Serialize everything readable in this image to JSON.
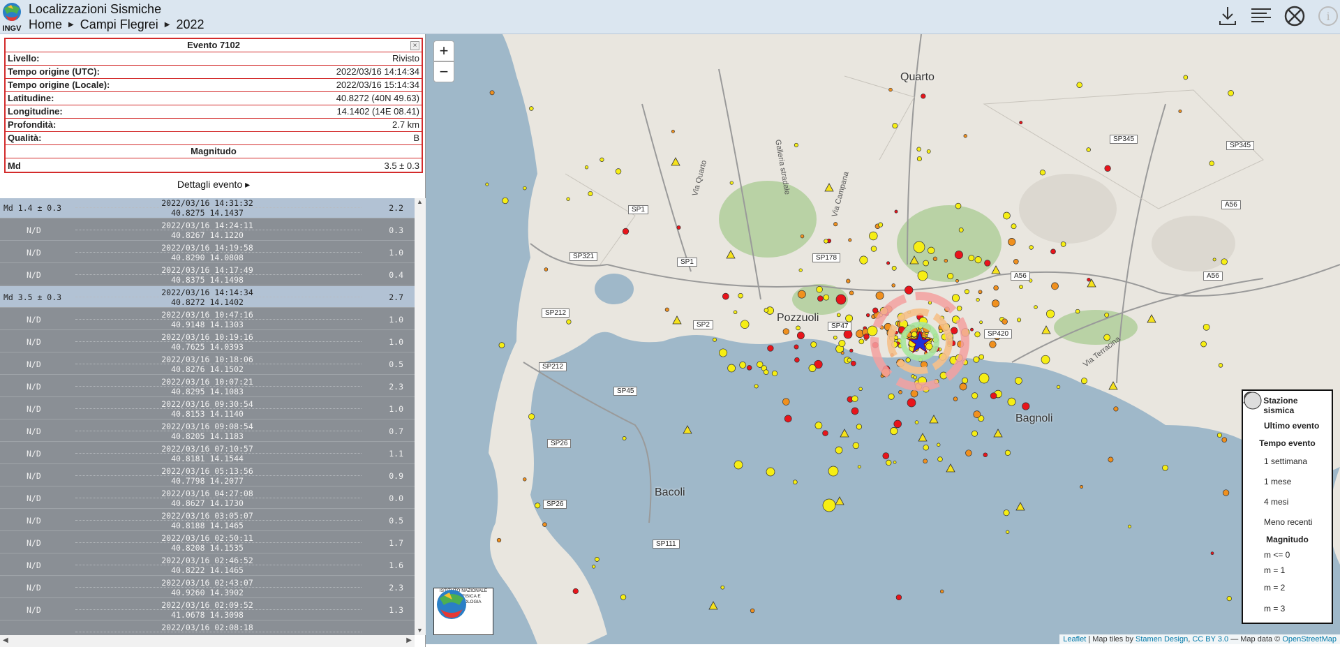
{
  "header": {
    "title": "Localizzazioni Sismiche",
    "logo_text": "INGV",
    "breadcrumb": [
      "Home",
      "Campi Flegrei",
      "2022"
    ]
  },
  "detail": {
    "title": "Evento 7102",
    "rows": [
      {
        "label": "Livello:",
        "value": "Rivisto"
      },
      {
        "label": "Tempo origine (UTC):",
        "value": "2022/03/16 14:14:34"
      },
      {
        "label": "Tempo origine (Locale):",
        "value": "2022/03/16 15:14:34"
      },
      {
        "label": "Latitudine:",
        "value": "40.8272 (40N 49.63)"
      },
      {
        "label": "Longitudine:",
        "value": "14.1402 (14E 08.41)"
      },
      {
        "label": "Profondità:",
        "value": "2.7 km"
      },
      {
        "label": "Qualità:",
        "value": "B"
      }
    ],
    "magnitude_header": "Magnitudo",
    "magnitude_label": "Md",
    "magnitude_value": "3.5 ± 0.3",
    "details_link": "Dettagli evento ▸"
  },
  "events": [
    {
      "mag": "Md 1.4 ± 0.3",
      "datetime": "2022/03/16 14:31:32",
      "coords": "40.8275 14.1437",
      "depth": "2.2",
      "hi": true
    },
    {
      "mag": "N/D",
      "datetime": "2022/03/16 14:24:11",
      "coords": "40.8267 14.1220",
      "depth": "0.3"
    },
    {
      "mag": "N/D",
      "datetime": "2022/03/16 14:19:58",
      "coords": "40.8290 14.0808",
      "depth": "1.0"
    },
    {
      "mag": "N/D",
      "datetime": "2022/03/16 14:17:49",
      "coords": "40.8375 14.1498",
      "depth": "0.4"
    },
    {
      "mag": "Md 3.5 ± 0.3",
      "datetime": "2022/03/16 14:14:34",
      "coords": "40.8272 14.1402",
      "depth": "2.7",
      "hi": true
    },
    {
      "mag": "N/D",
      "datetime": "2022/03/16 10:47:16",
      "coords": "40.9148 14.1303",
      "depth": "1.0"
    },
    {
      "mag": "N/D",
      "datetime": "2022/03/16 10:19:16",
      "coords": "40.7625 14.0393",
      "depth": "1.0"
    },
    {
      "mag": "N/D",
      "datetime": "2022/03/16 10:18:06",
      "coords": "40.8276 14.1502",
      "depth": "0.5"
    },
    {
      "mag": "N/D",
      "datetime": "2022/03/16 10:07:21",
      "coords": "40.8295 14.1083",
      "depth": "2.3"
    },
    {
      "mag": "N/D",
      "datetime": "2022/03/16 09:30:54",
      "coords": "40.8153 14.1140",
      "depth": "1.0"
    },
    {
      "mag": "N/D",
      "datetime": "2022/03/16 09:08:54",
      "coords": "40.8205 14.1183",
      "depth": "0.7"
    },
    {
      "mag": "N/D",
      "datetime": "2022/03/16 07:10:57",
      "coords": "40.8181 14.1544",
      "depth": "1.1"
    },
    {
      "mag": "N/D",
      "datetime": "2022/03/16 05:13:56",
      "coords": "40.7798 14.2077",
      "depth": "0.9"
    },
    {
      "mag": "N/D",
      "datetime": "2022/03/16 04:27:08",
      "coords": "40.8627 14.1730",
      "depth": "0.0"
    },
    {
      "mag": "N/D",
      "datetime": "2022/03/16 03:05:07",
      "coords": "40.8188 14.1465",
      "depth": "0.5"
    },
    {
      "mag": "N/D",
      "datetime": "2022/03/16 02:50:11",
      "coords": "40.8208 14.1535",
      "depth": "1.7"
    },
    {
      "mag": "N/D",
      "datetime": "2022/03/16 02:46:52",
      "coords": "40.8222 14.1465",
      "depth": "1.6"
    },
    {
      "mag": "N/D",
      "datetime": "2022/03/16 02:43:07",
      "coords": "40.9260 14.3902",
      "depth": "2.3"
    },
    {
      "mag": "N/D",
      "datetime": "2022/03/16 02:09:52",
      "coords": "41.0678 14.3098",
      "depth": "1.3"
    },
    {
      "mag": "",
      "datetime": "2022/03/16 02:08:18",
      "coords": "",
      "depth": ""
    }
  ],
  "map": {
    "zoom_in": "+",
    "zoom_out": "−",
    "places": [
      "Quarto",
      "Pozzuoli",
      "Bacoli",
      "Bagnoli"
    ],
    "roads": [
      "SP345",
      "SP345",
      "SP1",
      "SP1",
      "SP321",
      "SP178",
      "A56",
      "A56",
      "A56",
      "SP212",
      "SP2",
      "SP47",
      "SP420",
      "SP212",
      "SP45",
      "SP26",
      "SP26",
      "SP111"
    ],
    "street_labels": [
      "Galleria stradale",
      "Via Campana",
      "Via Terracina",
      "Via Quarto"
    ],
    "institute_logo": "ISTITUTO NAZIONALE DI GEOFISICA E VULCANOLOGIA",
    "colors": {
      "week": "#e8141b",
      "month": "#f0901e",
      "four_months": "#f6ee14",
      "older": "#22c41c",
      "station": "#f6e21c",
      "last_event": "#e8141b",
      "water": "#9fb8c9",
      "land": "#e9e6df"
    }
  },
  "legend": {
    "station": "Stazione sismica",
    "last_event": "Ultimo evento",
    "time_header": "Tempo evento",
    "time_items": [
      "1 settimana",
      "1 mese",
      "4 mesi",
      "Meno recenti"
    ],
    "mag_header": "Magnitudo",
    "mag_items": [
      "m <= 0",
      "m = 1",
      "m = 2",
      "m = 3"
    ]
  },
  "attribution": {
    "leaflet": "Leaflet",
    "text1": " | Map tiles by ",
    "stamen": "Stamen Design",
    "sep": ", ",
    "cc": "CC BY 3.0",
    "text2": " — Map data © ",
    "osm": "OpenStreetMap"
  }
}
